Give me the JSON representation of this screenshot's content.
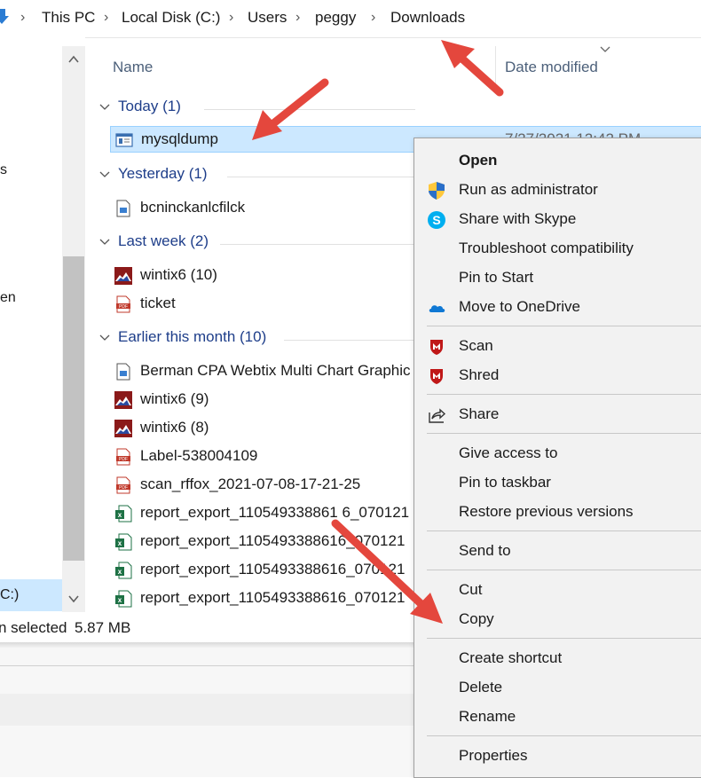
{
  "breadcrumb": [
    "This PC",
    "Local Disk (C:)",
    "Users",
    "peggy",
    "Downloads"
  ],
  "nav": {
    "partial_items": [
      "s",
      "en"
    ],
    "selected_drive": "C:)"
  },
  "columns": {
    "name": "Name",
    "date_modified": "Date modified"
  },
  "groups": [
    {
      "label": "Today (1)"
    },
    {
      "label": "Yesterday (1)"
    },
    {
      "label": "Last week (2)"
    },
    {
      "label": "Earlier this month (10)"
    }
  ],
  "files": [
    {
      "name": "mysqldump",
      "icon": "exe-window-icon",
      "date": "7/27/2021 12:42 PM"
    },
    {
      "name": "bcninckanlcfilck",
      "icon": "image-file-icon"
    },
    {
      "name": "wintix6 (10)",
      "icon": "wintix-app-icon"
    },
    {
      "name": "ticket",
      "icon": "pdf-icon"
    },
    {
      "name": "Berman CPA Webtix Multi Chart Graphic",
      "icon": "image-file-icon"
    },
    {
      "name": "wintix6 (9)",
      "icon": "wintix-app-icon"
    },
    {
      "name": "wintix6 (8)",
      "icon": "wintix-app-icon"
    },
    {
      "name": "Label-538004109",
      "icon": "pdf-icon"
    },
    {
      "name": "scan_rffox_2021-07-08-17-21-25",
      "icon": "pdf-icon"
    },
    {
      "name": "report_export_110549338861 6_070121",
      "icon": "excel-icon"
    },
    {
      "name": "report_export_1105493388616_070121",
      "icon": "excel-icon"
    },
    {
      "name": "report_export_1105493388616_070121",
      "icon": "excel-icon"
    },
    {
      "name": "report_export_1105493388616_070121",
      "icon": "excel-icon"
    }
  ],
  "status": {
    "selected": "n selected",
    "size": "5.87 MB"
  },
  "context_menu": {
    "open": "Open",
    "run_as_admin": "Run as administrator",
    "share_skype": "Share with Skype",
    "troubleshoot": "Troubleshoot compatibility",
    "pin_start": "Pin to Start",
    "onedrive": "Move to OneDrive",
    "scan": "Scan",
    "shred": "Shred",
    "share": "Share",
    "give_access": "Give access to",
    "pin_taskbar": "Pin to taskbar",
    "restore": "Restore previous versions",
    "send_to": "Send to",
    "cut": "Cut",
    "copy": "Copy",
    "create_shortcut": "Create shortcut",
    "delete": "Delete",
    "rename": "Rename",
    "properties": "Properties"
  },
  "colors": {
    "selection": "#cce8ff",
    "group_text": "#1e3e8a",
    "arrow": "#e4473d",
    "mcafee_red": "#c01818"
  }
}
